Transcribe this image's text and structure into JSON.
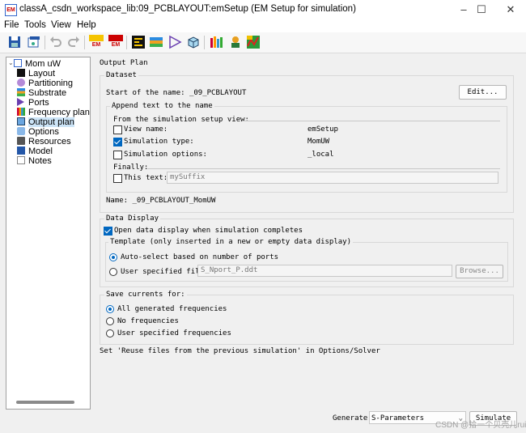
{
  "window": {
    "title": "classA_csdn_workspace_lib:09_PCBLAYOUT:emSetup (EM Setup for simulation)",
    "app_icon": "EM",
    "minimize": "–",
    "maximize": "☐",
    "close": "✕"
  },
  "menu": [
    "File",
    "Tools",
    "View",
    "Help"
  ],
  "toolbar": {
    "em_label_1": "EM",
    "em_label_2": "EM"
  },
  "tree": {
    "root": "Mom uW",
    "items": [
      "Layout",
      "Partitioning",
      "Substrate",
      "Ports",
      "Frequency plan",
      "Output plan",
      "Options",
      "Resources",
      "Model",
      "Notes"
    ],
    "selected": "Output plan"
  },
  "output_plan": {
    "title": "Output Plan",
    "dataset": {
      "title": "Dataset",
      "start_label": "Start of the name: _09_PCBLAYOUT",
      "edit_button": "Edit...",
      "append": {
        "title": "Append text to the name",
        "from_label": "From the simulation setup view:",
        "view_name": {
          "label": "View name:",
          "checked": false,
          "value": "emSetup"
        },
        "sim_type": {
          "label": "Simulation type:",
          "checked": true,
          "value": "MomUW"
        },
        "sim_options": {
          "label": "Simulation options:",
          "checked": false,
          "value": "_local"
        },
        "finally_label": "Finally:",
        "this_text": {
          "label": "This text:",
          "checked": false,
          "placeholder": "mySuffix"
        }
      },
      "name_label": "Name: _09_PCBLAYOUT_MomUW"
    },
    "data_display": {
      "title": "Data Display",
      "open_label": "Open data display when simulation completes",
      "open_checked": true,
      "template_title": "Template (only inserted in a new or empty data display)",
      "auto_select": "Auto-select based on number of ports",
      "user_file": "User specified file",
      "file_value": "S_Nport_P.ddt",
      "browse_button": "Browse...",
      "selected": "auto"
    },
    "save_currents": {
      "title": "Save currents for:",
      "options": [
        "All generated frequencies",
        "No frequencies",
        "User specified frequencies"
      ],
      "selected_index": 0
    },
    "reuse_note": "Set 'Reuse files from the previous simulation' in Options/Solver"
  },
  "footer": {
    "generate_label": "Generate:",
    "generate_value": "S-Parameters",
    "simulate_button": "Simulate",
    "watermark": "CSDN @拾一个贝壳儿rui"
  },
  "colors": {
    "accent": "#0067c0",
    "selection": "#cce4f7",
    "panel_bg": "#f0f0f0"
  }
}
